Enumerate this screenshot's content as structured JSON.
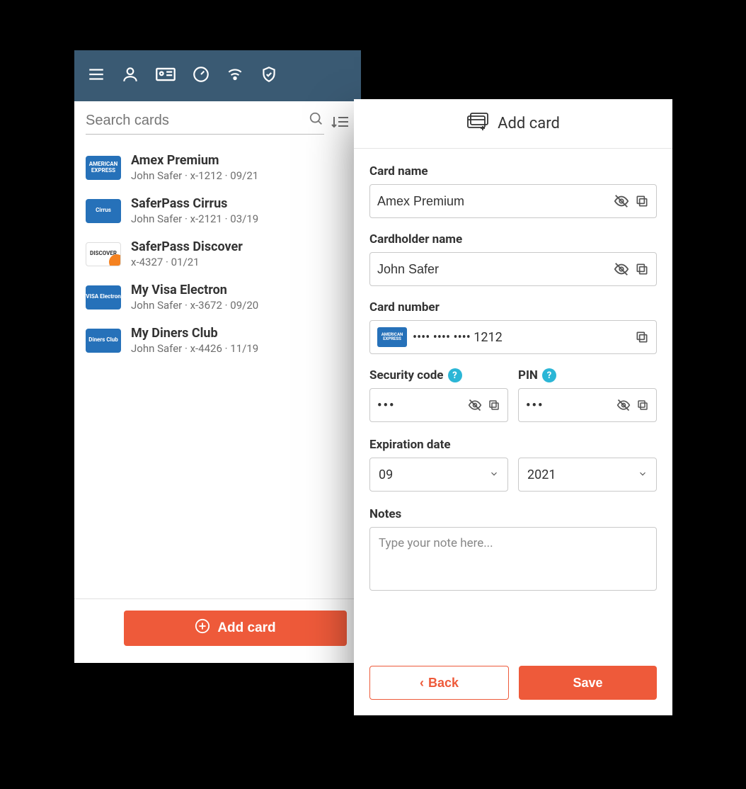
{
  "left": {
    "search_placeholder": "Search cards",
    "add_button": "Add card",
    "cards": [
      {
        "title": "Amex Premium",
        "sub": "John Safer · x-1212 · 09/21",
        "logo": "amex",
        "logo_text": "AMERICAN\nEXPRESS"
      },
      {
        "title": "SaferPass Cirrus",
        "sub": "John Safer · x-2121 · 03/19",
        "logo": "cirrus",
        "logo_text": "Cirrus"
      },
      {
        "title": "SaferPass Discover",
        "sub": "x-4327 · 01/21",
        "logo": "discover",
        "logo_text": "DISCOVER"
      },
      {
        "title": "My Visa Electron",
        "sub": "John Safer · x-3672 · 09/20",
        "logo": "visa",
        "logo_text": "VISA\nElectron"
      },
      {
        "title": "My Diners Club",
        "sub": "John Safer · x-4426 · 11/19",
        "logo": "diners",
        "logo_text": "Diners Club"
      }
    ]
  },
  "right": {
    "header": "Add card",
    "labels": {
      "card_name": "Card name",
      "cardholder": "Cardholder name",
      "card_number": "Card number",
      "security": "Security code",
      "pin": "PIN",
      "expiration": "Expiration date",
      "notes": "Notes"
    },
    "values": {
      "card_name": "Amex Premium",
      "cardholder": "John Safer",
      "card_number": "•••• •••• •••• 1212",
      "security": "•••",
      "pin": "•••",
      "exp_month": "09",
      "exp_year": "2021",
      "card_brand": "AMERICAN\nEXPRESS"
    },
    "notes_placeholder": "Type your note here...",
    "buttons": {
      "back": "Back",
      "save": "Save"
    }
  }
}
